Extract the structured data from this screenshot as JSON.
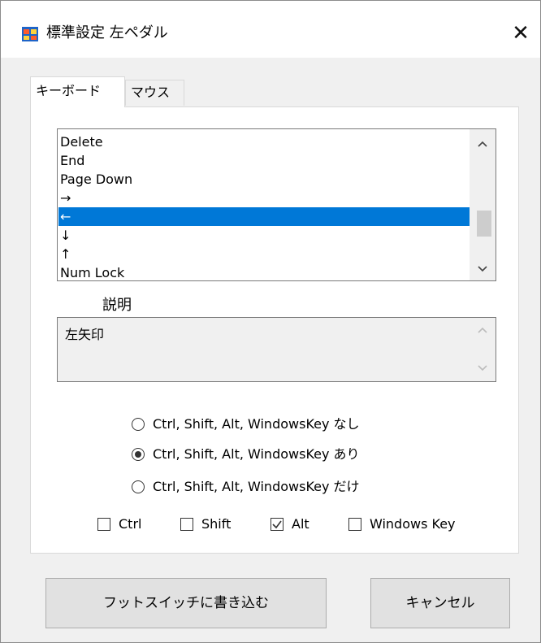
{
  "window": {
    "title": "標準設定 左ペダル",
    "close_glyph": "✕",
    "icon_name": "app-window-icon"
  },
  "tabs": [
    {
      "label": "キーボード",
      "active": true
    },
    {
      "label": "マウス",
      "active": false
    }
  ],
  "key_list": {
    "items": [
      "Delete",
      "End",
      "Page Down",
      "→",
      "←",
      "↓",
      "↑",
      "Num Lock"
    ],
    "selected_index": 4,
    "scroll_up_glyph": "^",
    "scroll_down_glyph": "v",
    "selection_color": "#0078d7"
  },
  "description": {
    "label": "説明",
    "text": "左矢印",
    "scroll_up_glyph": "^",
    "scroll_down_glyph": "v"
  },
  "modifier_mode": {
    "options": [
      {
        "label": "Ctrl, Shift, Alt, WindowsKey なし",
        "checked": false
      },
      {
        "label": "Ctrl, Shift, Alt, WindowsKey あり",
        "checked": true
      },
      {
        "label": "Ctrl, Shift, Alt, WindowsKey だけ",
        "checked": false
      }
    ]
  },
  "modifiers": [
    {
      "label": "Ctrl",
      "checked": false
    },
    {
      "label": "Shift",
      "checked": false
    },
    {
      "label": "Alt",
      "checked": true
    },
    {
      "label": "Windows Key",
      "checked": false
    }
  ],
  "buttons": {
    "write_label": "フットスイッチに書き込む",
    "cancel_label": "キャンセル"
  }
}
